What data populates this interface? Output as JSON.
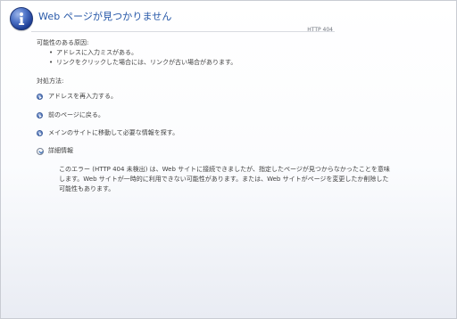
{
  "header": {
    "title": "Web ページが見つかりません",
    "http_code": "HTTP 404",
    "icon": "info-icon"
  },
  "causes": {
    "heading": "可能性のある原因:",
    "items": [
      "アドレスに入力ミスがある。",
      "リンクをクリックした場合には、リンクが古い場合があります。"
    ]
  },
  "actions": {
    "heading": "対処方法:",
    "items": [
      {
        "label": "アドレスを再入力する。",
        "icon": "arrow-circle-icon"
      },
      {
        "label": "前のページに戻る。",
        "icon": "arrow-circle-icon"
      },
      {
        "label": "メインのサイトに移動して必要な情報を探す。",
        "icon": "arrow-circle-icon"
      }
    ]
  },
  "details": {
    "label": "詳細情報",
    "icon": "chevron-down-circle-icon",
    "body": "このエラー (HTTP 404 未検出) は、Web サイトに接続できましたが、指定したページが見つからなかったことを意味します。Web サイトが一時的に利用できない可能性があります。または、Web サイトがページを変更したか削除した可能性もあります。"
  },
  "colors": {
    "title": "#2758a8",
    "text": "#404040",
    "rule": "#d9dbe1",
    "icon": "#2f56ad"
  }
}
